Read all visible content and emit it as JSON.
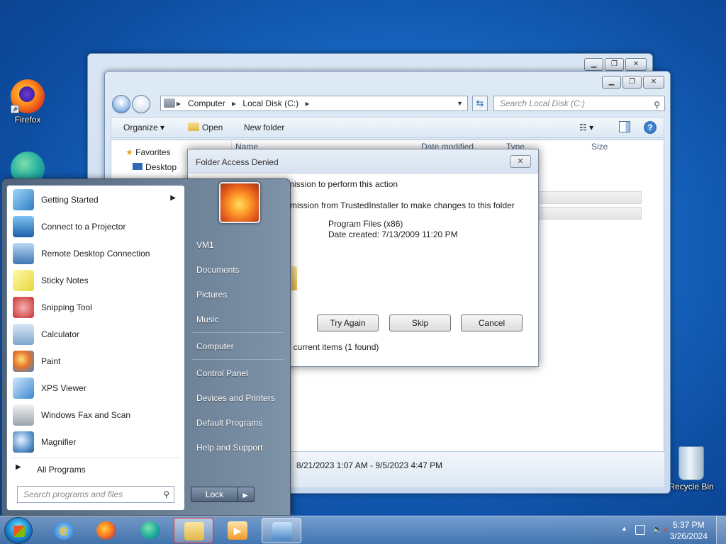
{
  "desktop": {
    "icons": [
      {
        "label": "Firefox"
      },
      {
        "label": "Recycle Bin"
      }
    ]
  },
  "explorer": {
    "address": {
      "root": "Computer",
      "current": "Local Disk (C:)"
    },
    "search_placeholder": "Search Local Disk (C:)",
    "toolbar": {
      "organize": "Organize",
      "open": "Open",
      "new_folder": "New folder"
    },
    "nav": {
      "favorites": "Favorites",
      "desktop": "Desktop"
    },
    "columns": {
      "name": "Name",
      "date": "Date modified",
      "type": "Type",
      "size": "Size"
    },
    "details_range": "8/21/2023 1:07 AM - 9/5/2023 4:47 PM"
  },
  "dialog": {
    "title": "Folder Access Denied",
    "line1": "mission to perform this action",
    "line2": "rmission from TrustedInstaller to make changes to this folder",
    "item_name": "Program Files (x86)",
    "item_date": "Date created: 7/13/2009 11:20 PM",
    "buttons": {
      "try_again": "Try Again",
      "skip": "Skip",
      "cancel": "Cancel"
    },
    "footer": "ll current items (1 found)"
  },
  "start_menu": {
    "programs": [
      {
        "label": "Getting Started",
        "has_submenu": true
      },
      {
        "label": "Connect to a Projector"
      },
      {
        "label": "Remote Desktop Connection"
      },
      {
        "label": "Sticky Notes"
      },
      {
        "label": "Snipping Tool"
      },
      {
        "label": "Calculator"
      },
      {
        "label": "Paint"
      },
      {
        "label": "XPS Viewer"
      },
      {
        "label": "Windows Fax and Scan"
      },
      {
        "label": "Magnifier"
      }
    ],
    "all_programs": "All Programs",
    "search_placeholder": "Search programs and files",
    "right_items": [
      "VM1",
      "Documents",
      "Pictures",
      "Music",
      "Computer",
      "Control Panel",
      "Devices and Printers",
      "Default Programs",
      "Help and Support"
    ],
    "lock": "Lock"
  },
  "taskbar": {
    "clock_time": "5:37 PM",
    "clock_date": "3/26/2024"
  }
}
